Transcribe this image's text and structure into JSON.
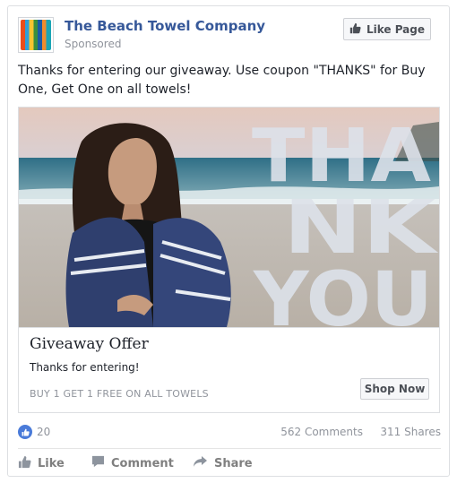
{
  "post": {
    "page_name": "The Beach Towel Company",
    "sponsored": "Sponsored",
    "like_page_label": "Like Page",
    "text": "Thanks for entering our giveaway. Use coupon \"THANKS\" for Buy One, Get One on all towels!"
  },
  "ad": {
    "image_text": [
      "THA",
      "NK",
      "YOU"
    ],
    "title": "Giveaway Offer",
    "description": "Thanks for entering!",
    "caption": "BUY 1 GET 1 FREE ON ALL TOWELS",
    "cta_label": "Shop Now"
  },
  "stats": {
    "likes": "20",
    "comments": "562 Comments",
    "shares": "311 Shares"
  },
  "actions": {
    "like": "Like",
    "comment": "Comment",
    "share": "Share"
  },
  "colors": {
    "page_name": "#365899",
    "like_badge": "#4a7bd9",
    "muted": "#90949c"
  },
  "icons": {
    "like_page": "thumbs-up-icon",
    "like": "thumbs-up-icon",
    "comment": "speech-bubble-icon",
    "share": "share-arrow-icon"
  }
}
